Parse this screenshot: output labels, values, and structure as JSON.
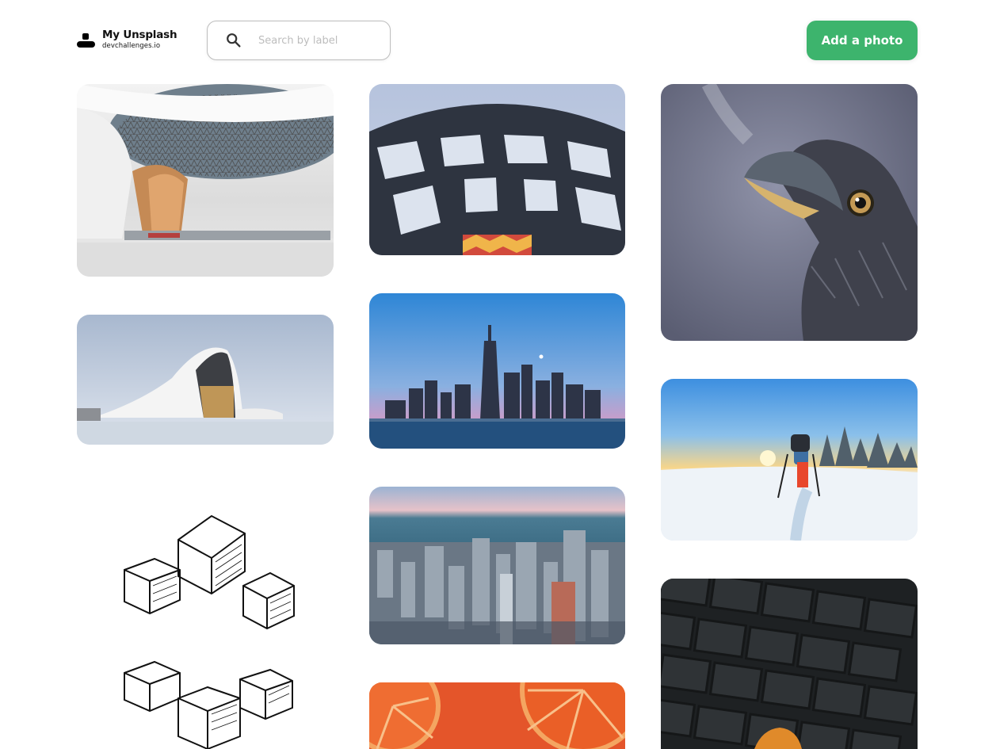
{
  "brand": {
    "title": "My Unsplash",
    "subtitle": "devchallenges.io"
  },
  "search": {
    "placeholder": "Search by label",
    "value": ""
  },
  "actions": {
    "add_photo_label": "Add a photo"
  },
  "colors": {
    "accent": "#3db46d",
    "input_border": "#bdbdbd"
  },
  "gallery": {
    "photos": [
      {
        "subject": "airport-terminal-ceiling"
      },
      {
        "subject": "building-facade-from-below"
      },
      {
        "subject": "eagle-breathing-steam"
      },
      {
        "subject": "curved-white-building"
      },
      {
        "subject": "city-skyline-at-dusk"
      },
      {
        "subject": "hiker-in-snow-at-sunrise"
      },
      {
        "subject": "sketched-cubes"
      },
      {
        "subject": "aerial-city-by-lake"
      },
      {
        "subject": "orange-slices"
      },
      {
        "subject": "leaf-on-paving-stones"
      }
    ]
  }
}
